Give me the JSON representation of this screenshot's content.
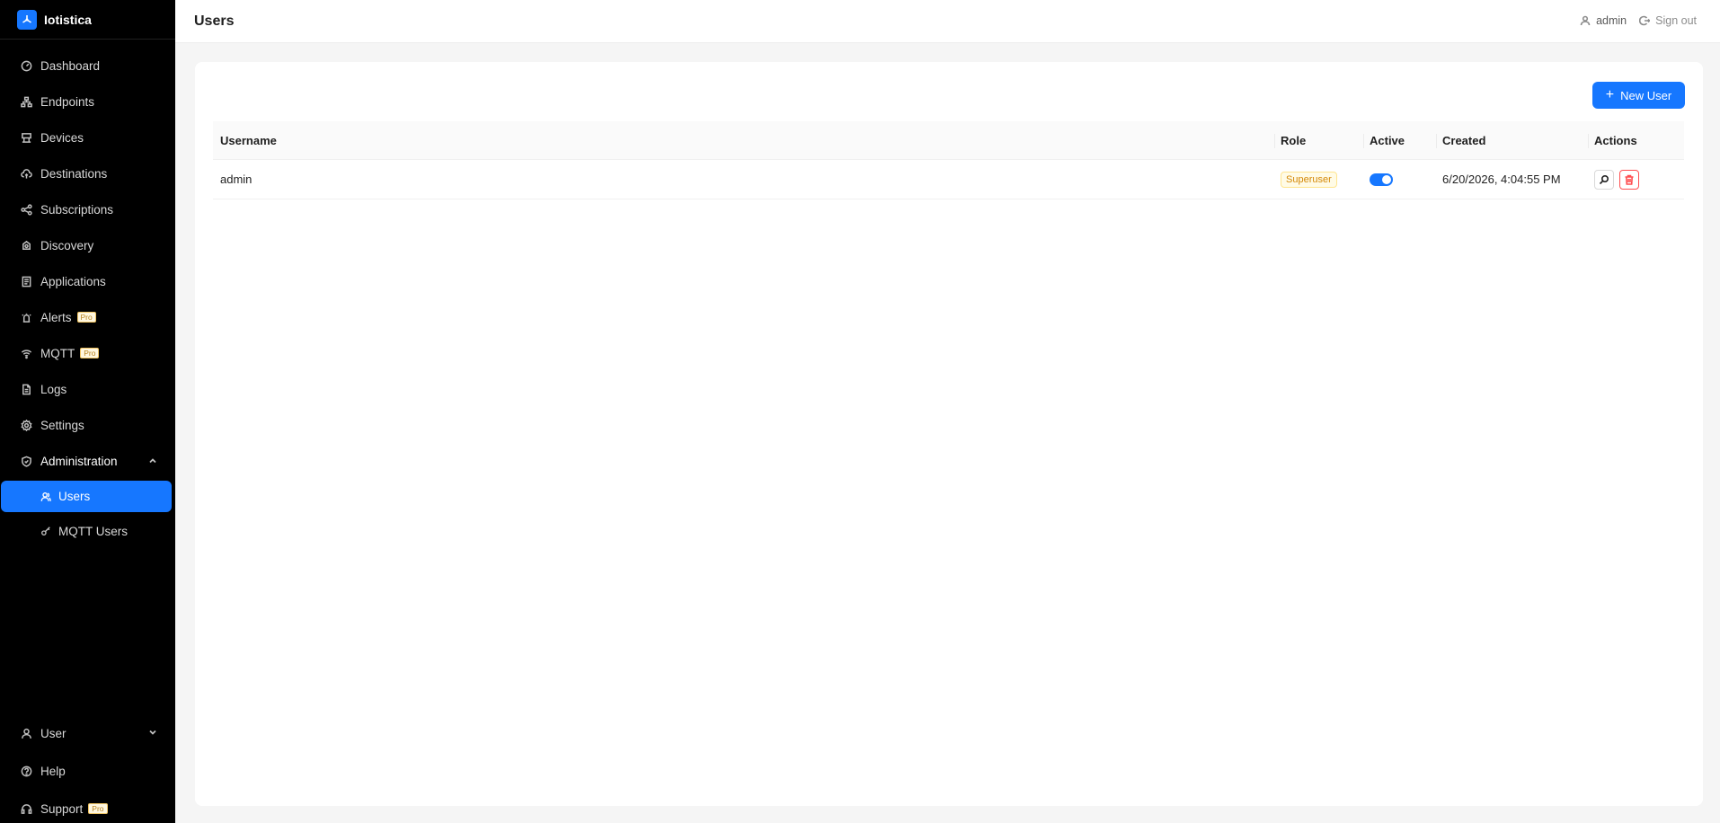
{
  "app": {
    "name": "Iotistica"
  },
  "sidebar": {
    "items": [
      {
        "label": "Dashboard",
        "icon": "dashboard-icon"
      },
      {
        "label": "Endpoints",
        "icon": "endpoints-icon"
      },
      {
        "label": "Devices",
        "icon": "devices-icon"
      },
      {
        "label": "Destinations",
        "icon": "cloud-upload-icon"
      },
      {
        "label": "Subscriptions",
        "icon": "share-icon"
      },
      {
        "label": "Discovery",
        "icon": "discovery-icon"
      },
      {
        "label": "Applications",
        "icon": "applications-icon"
      },
      {
        "label": "Alerts",
        "icon": "alarm-icon",
        "badge": "Pro"
      },
      {
        "label": "MQTT",
        "icon": "wifi-icon",
        "badge": "Pro"
      },
      {
        "label": "Logs",
        "icon": "file-icon"
      },
      {
        "label": "Settings",
        "icon": "gear-icon"
      }
    ],
    "admin": {
      "label": "Administration",
      "icon": "shield-icon",
      "children": [
        {
          "label": "Users",
          "icon": "users-icon",
          "selected": true
        },
        {
          "label": "MQTT Users",
          "icon": "key-icon"
        }
      ]
    },
    "bottom": [
      {
        "label": "User",
        "icon": "user-icon"
      },
      {
        "label": "Help",
        "icon": "help-icon"
      },
      {
        "label": "Support",
        "icon": "headset-icon",
        "badge": "Pro"
      }
    ]
  },
  "header": {
    "title": "Users",
    "username": "admin",
    "signout_label": "Sign out"
  },
  "toolbar": {
    "new_user_label": "New User"
  },
  "table": {
    "columns": [
      "Username",
      "Role",
      "Active",
      "Created",
      "Actions"
    ],
    "rows": [
      {
        "username": "admin",
        "role": "Superuser",
        "active": true,
        "created": "6/20/2026, 4:04:55 PM"
      }
    ]
  },
  "colors": {
    "accent": "#1677ff",
    "sidebar_bg": "#000000",
    "role_tag": "#d48806",
    "danger": "#ff4d4f",
    "pro_badge": "#b7821c"
  }
}
